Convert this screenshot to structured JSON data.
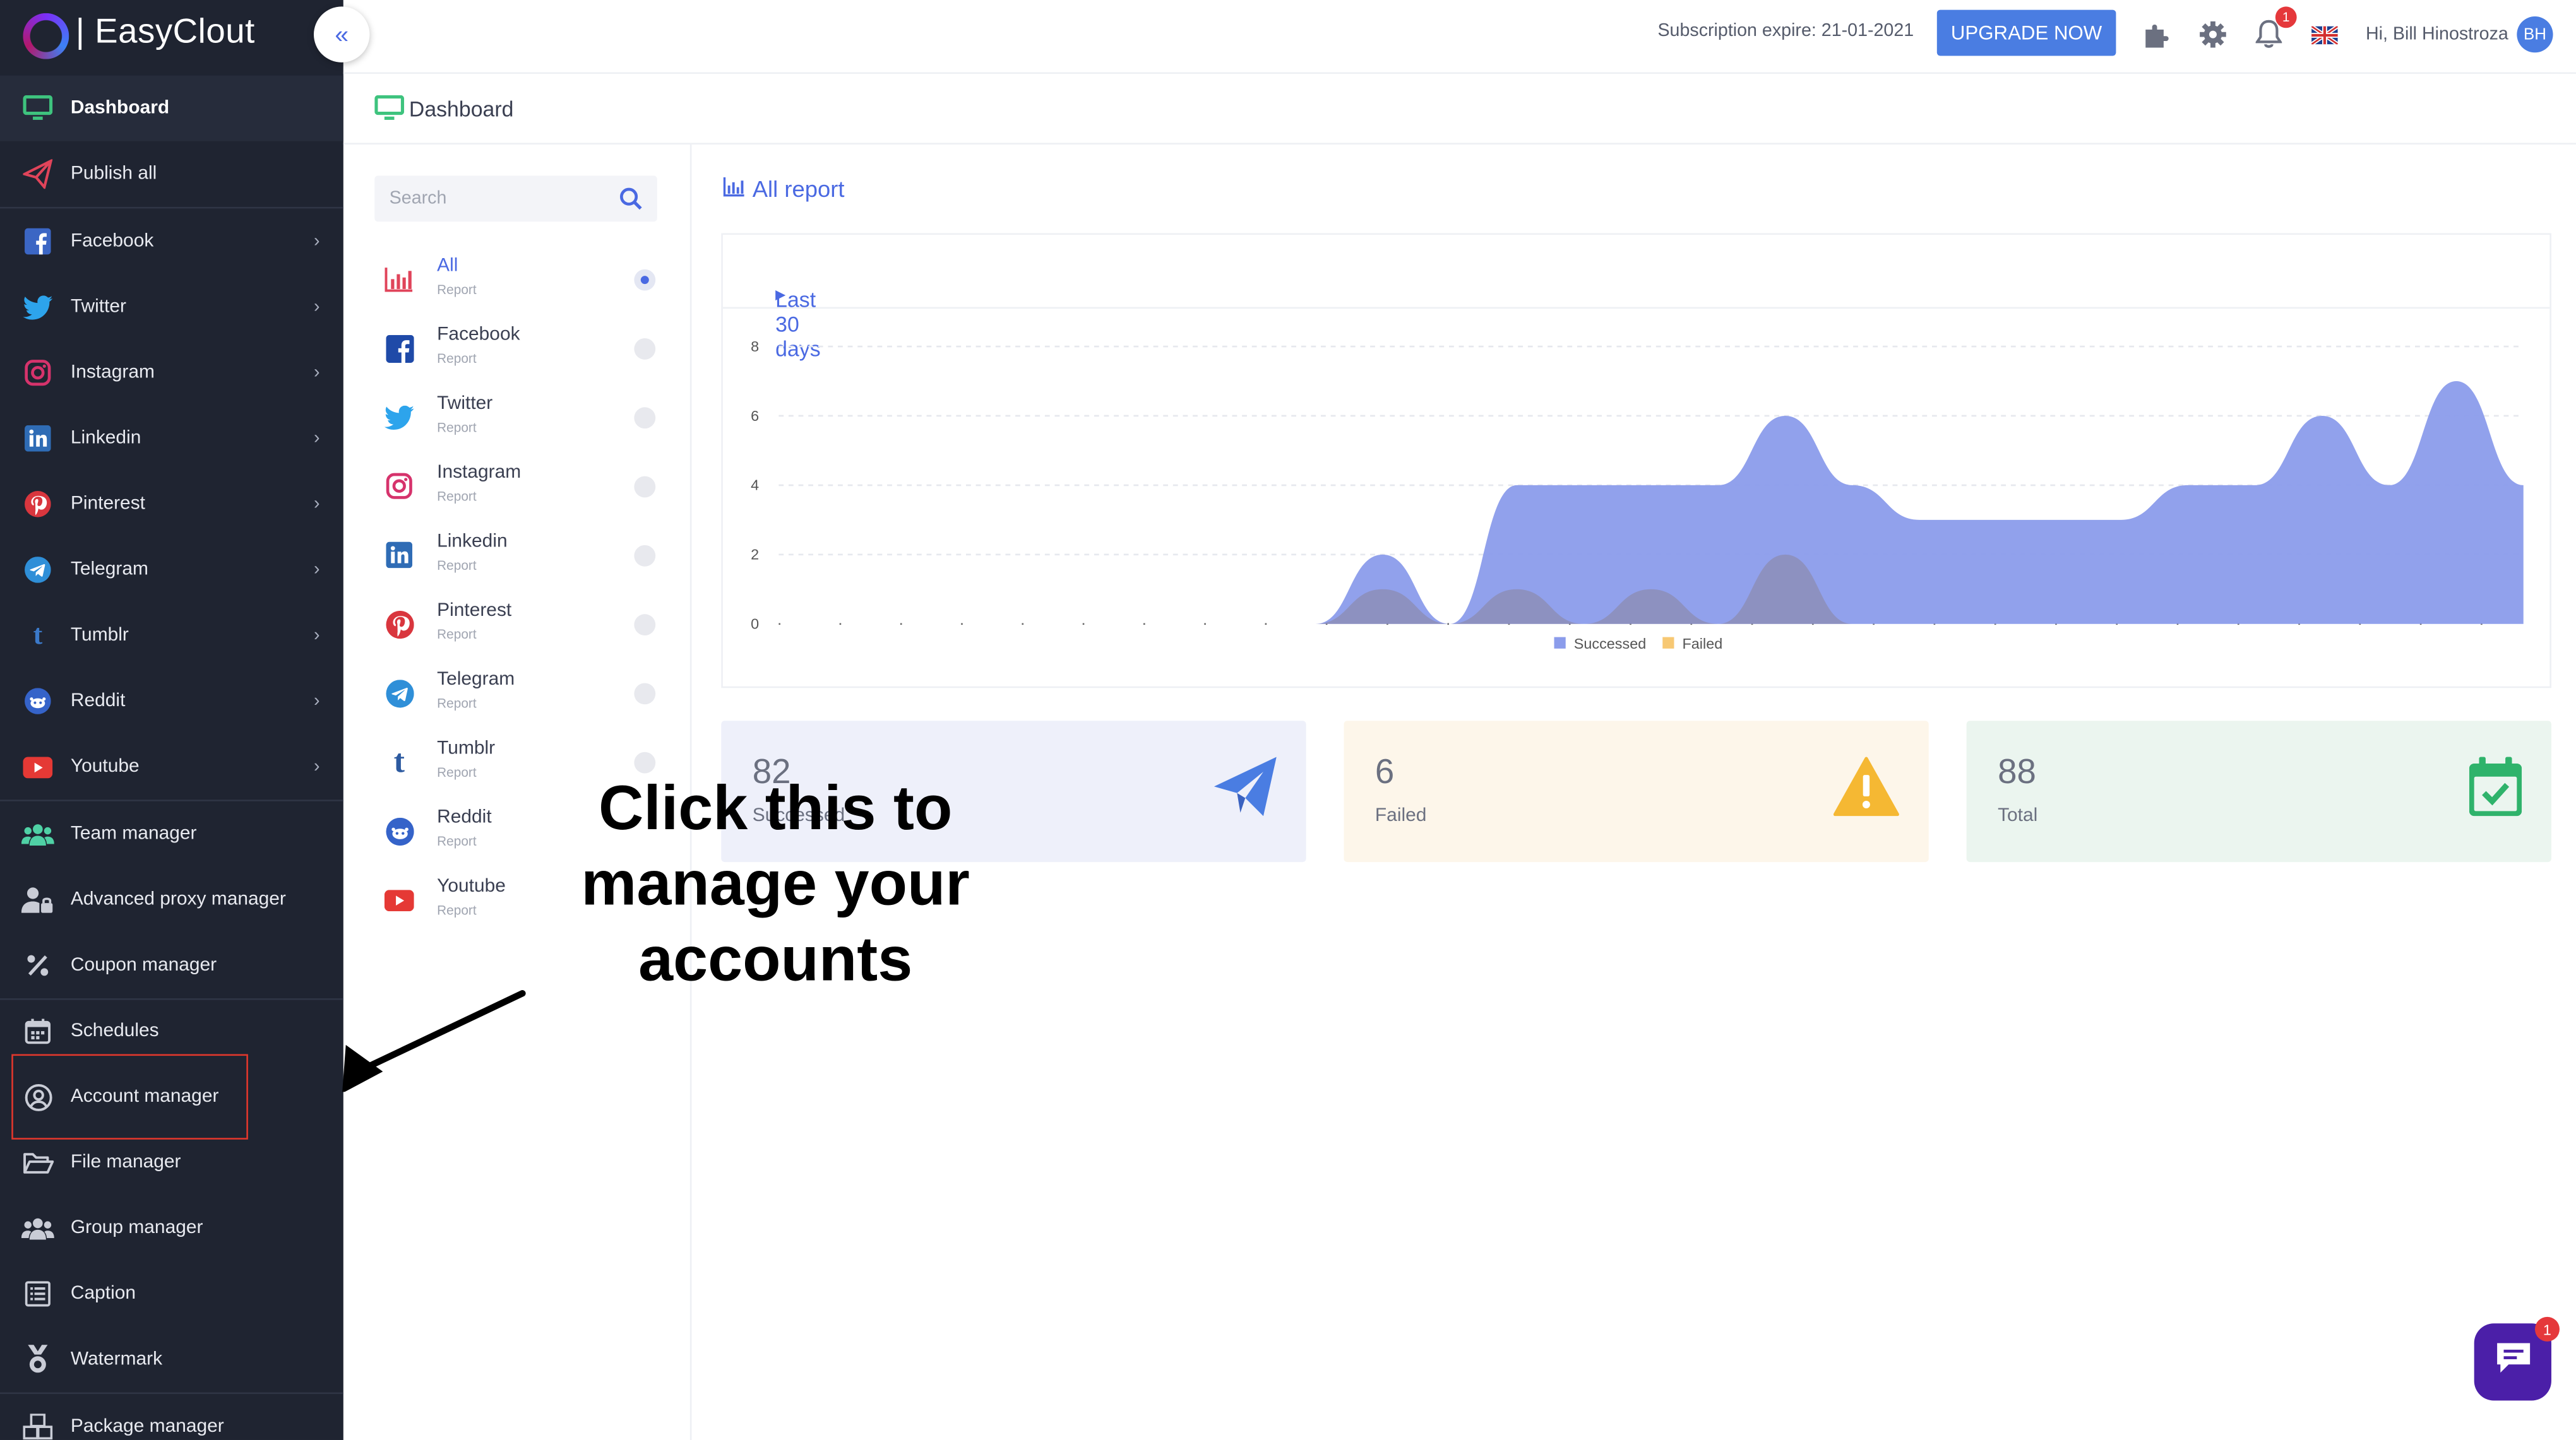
{
  "brand": {
    "name": "| EasyClout"
  },
  "topbar": {
    "subscription": "Subscription expire: 21-01-2021",
    "upgrade_label": "UPGRADE NOW",
    "notification_count": "1",
    "greeting": "Hi, Bill Hinostroza",
    "avatar_initials": "BH"
  },
  "sidebar": {
    "items": [
      {
        "label": "Dashboard",
        "icon": "monitor-icon"
      },
      {
        "label": "Publish all",
        "icon": "paper-plane-icon"
      },
      {
        "label": "Facebook",
        "icon": "facebook-icon"
      },
      {
        "label": "Twitter",
        "icon": "twitter-icon"
      },
      {
        "label": "Instagram",
        "icon": "instagram-icon"
      },
      {
        "label": "Linkedin",
        "icon": "linkedin-icon"
      },
      {
        "label": "Pinterest",
        "icon": "pinterest-icon"
      },
      {
        "label": "Telegram",
        "icon": "telegram-icon"
      },
      {
        "label": "Tumblr",
        "icon": "tumblr-icon"
      },
      {
        "label": "Reddit",
        "icon": "reddit-icon"
      },
      {
        "label": "Youtube",
        "icon": "youtube-icon"
      },
      {
        "label": "Team manager",
        "icon": "users-icon"
      },
      {
        "label": "Advanced proxy manager",
        "icon": "user-lock-icon"
      },
      {
        "label": "Coupon manager",
        "icon": "percent-icon"
      },
      {
        "label": "Schedules",
        "icon": "calendar-icon"
      },
      {
        "label": "Account manager",
        "icon": "user-circle-icon"
      },
      {
        "label": "File manager",
        "icon": "folder-open-icon"
      },
      {
        "label": "Group manager",
        "icon": "users-group-icon"
      },
      {
        "label": "Caption",
        "icon": "list-icon"
      },
      {
        "label": "Watermark",
        "icon": "medal-icon"
      },
      {
        "label": "Package manager",
        "icon": "boxes-icon"
      }
    ]
  },
  "breadcrumb": {
    "title": "Dashboard"
  },
  "reports": {
    "search_placeholder": "Search",
    "items": [
      {
        "name": "All",
        "sub": "Report"
      },
      {
        "name": "Facebook",
        "sub": "Report"
      },
      {
        "name": "Twitter",
        "sub": "Report"
      },
      {
        "name": "Instagram",
        "sub": "Report"
      },
      {
        "name": "Linkedin",
        "sub": "Report"
      },
      {
        "name": "Pinterest",
        "sub": "Report"
      },
      {
        "name": "Telegram",
        "sub": "Report"
      },
      {
        "name": "Tumblr",
        "sub": "Report"
      },
      {
        "name": "Reddit",
        "sub": "Report"
      },
      {
        "name": "Youtube",
        "sub": "Report"
      }
    ]
  },
  "main": {
    "title": "All report",
    "period": "Last 30 days"
  },
  "chart_data": {
    "type": "area",
    "y_ticks": [
      "8",
      "6",
      "4",
      "2",
      "0"
    ],
    "ylim": [
      0,
      8
    ],
    "grid": true,
    "legend_position": "bottom",
    "series": [
      {
        "name": "Successed",
        "color": "#8b9ceb",
        "values": [
          0,
          0,
          0,
          0,
          0,
          0,
          0,
          0,
          0,
          2,
          0,
          4,
          4,
          4,
          4,
          6,
          4,
          3,
          3,
          3,
          3,
          4,
          4,
          6,
          4,
          7,
          4
        ]
      },
      {
        "name": "Failed",
        "color": "#f7c873",
        "values": [
          0,
          0,
          0,
          0,
          0,
          0,
          0,
          0,
          0,
          1,
          0,
          1,
          0,
          1,
          0,
          2,
          0,
          0,
          0,
          0,
          0,
          0,
          0,
          0,
          0,
          0,
          0
        ]
      }
    ]
  },
  "stats": [
    {
      "value": "82",
      "label": "Successed",
      "bg": "#eef0fa",
      "icon": "paper-plane-icon"
    },
    {
      "value": "6",
      "label": "Failed",
      "bg": "#fdf6ea",
      "icon": "warning-icon"
    },
    {
      "value": "88",
      "label": "Total",
      "bg": "#ebf5ef",
      "icon": "calendar-check-icon"
    }
  ],
  "annotation": {
    "line1": "Click this to",
    "line2": "manage your",
    "line3": "accounts"
  },
  "chat": {
    "badge": "1"
  }
}
